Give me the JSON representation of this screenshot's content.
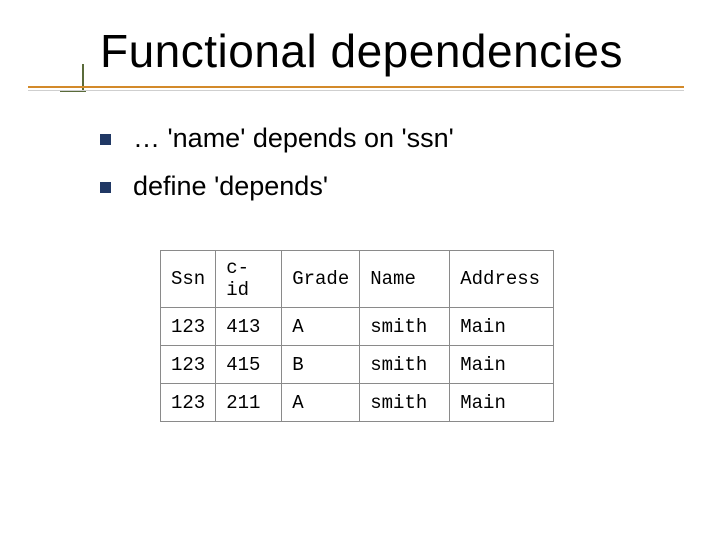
{
  "title": "Functional dependencies",
  "bullets": [
    "… 'name' depends on 'ssn'",
    "define 'depends'"
  ],
  "table": {
    "headers": [
      "Ssn",
      "c-id",
      "Grade",
      "Name",
      "Address"
    ],
    "rows": [
      [
        "123",
        "413",
        "A",
        "smith",
        "Main"
      ],
      [
        "123",
        "415",
        "B",
        "smith",
        "Main"
      ],
      [
        "123",
        "211",
        "A",
        "smith",
        "Main"
      ]
    ]
  }
}
